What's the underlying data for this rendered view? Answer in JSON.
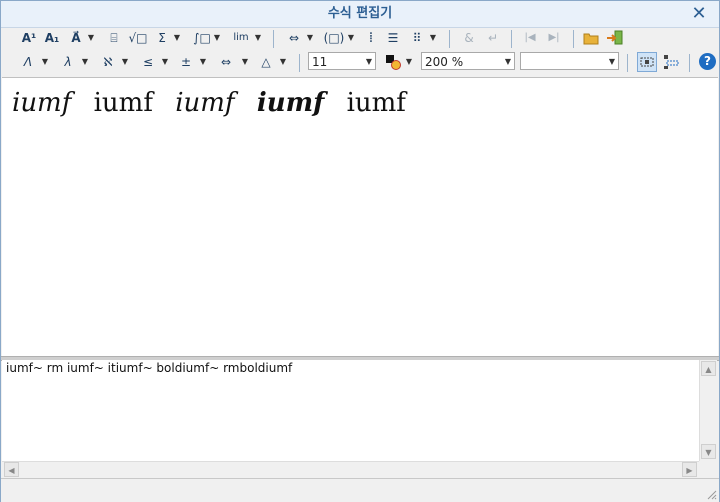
{
  "window": {
    "title": "수식 편집기"
  },
  "toolbar1": {
    "superscript": "A¹",
    "subscript": "A₁",
    "vector": "A⃗",
    "fraction": "⌸",
    "root": "√□",
    "sum": "Σ",
    "integral": "∫□",
    "limit": "lim",
    "arrow": "⇔",
    "bracket": "(□)",
    "matrix_col": "⁞",
    "rows": "☰",
    "matrix": "⠿",
    "ampersand": "&",
    "newline": "↵",
    "move_left": "|◀",
    "move_right": "▶|"
  },
  "toolbar2": {
    "greek_upper": "Λ",
    "greek_lower": "λ",
    "hebrew": "ℵ",
    "relation": "≤",
    "operator": "±",
    "arrows": "⇔",
    "shapes": "△",
    "font_size": "11",
    "zoom": "200 %",
    "font_name": ""
  },
  "formula": {
    "t1": "iumf",
    "t2": "iumf",
    "t3": "iumf",
    "t4": "iumf",
    "t5": "iumf"
  },
  "editor": {
    "script": "iumf~ rm iumf~ itiumf~ boldiumf~ rmboldiumf"
  },
  "colors": {
    "title": "#2d5f93",
    "accent": "#1f6dc2"
  }
}
